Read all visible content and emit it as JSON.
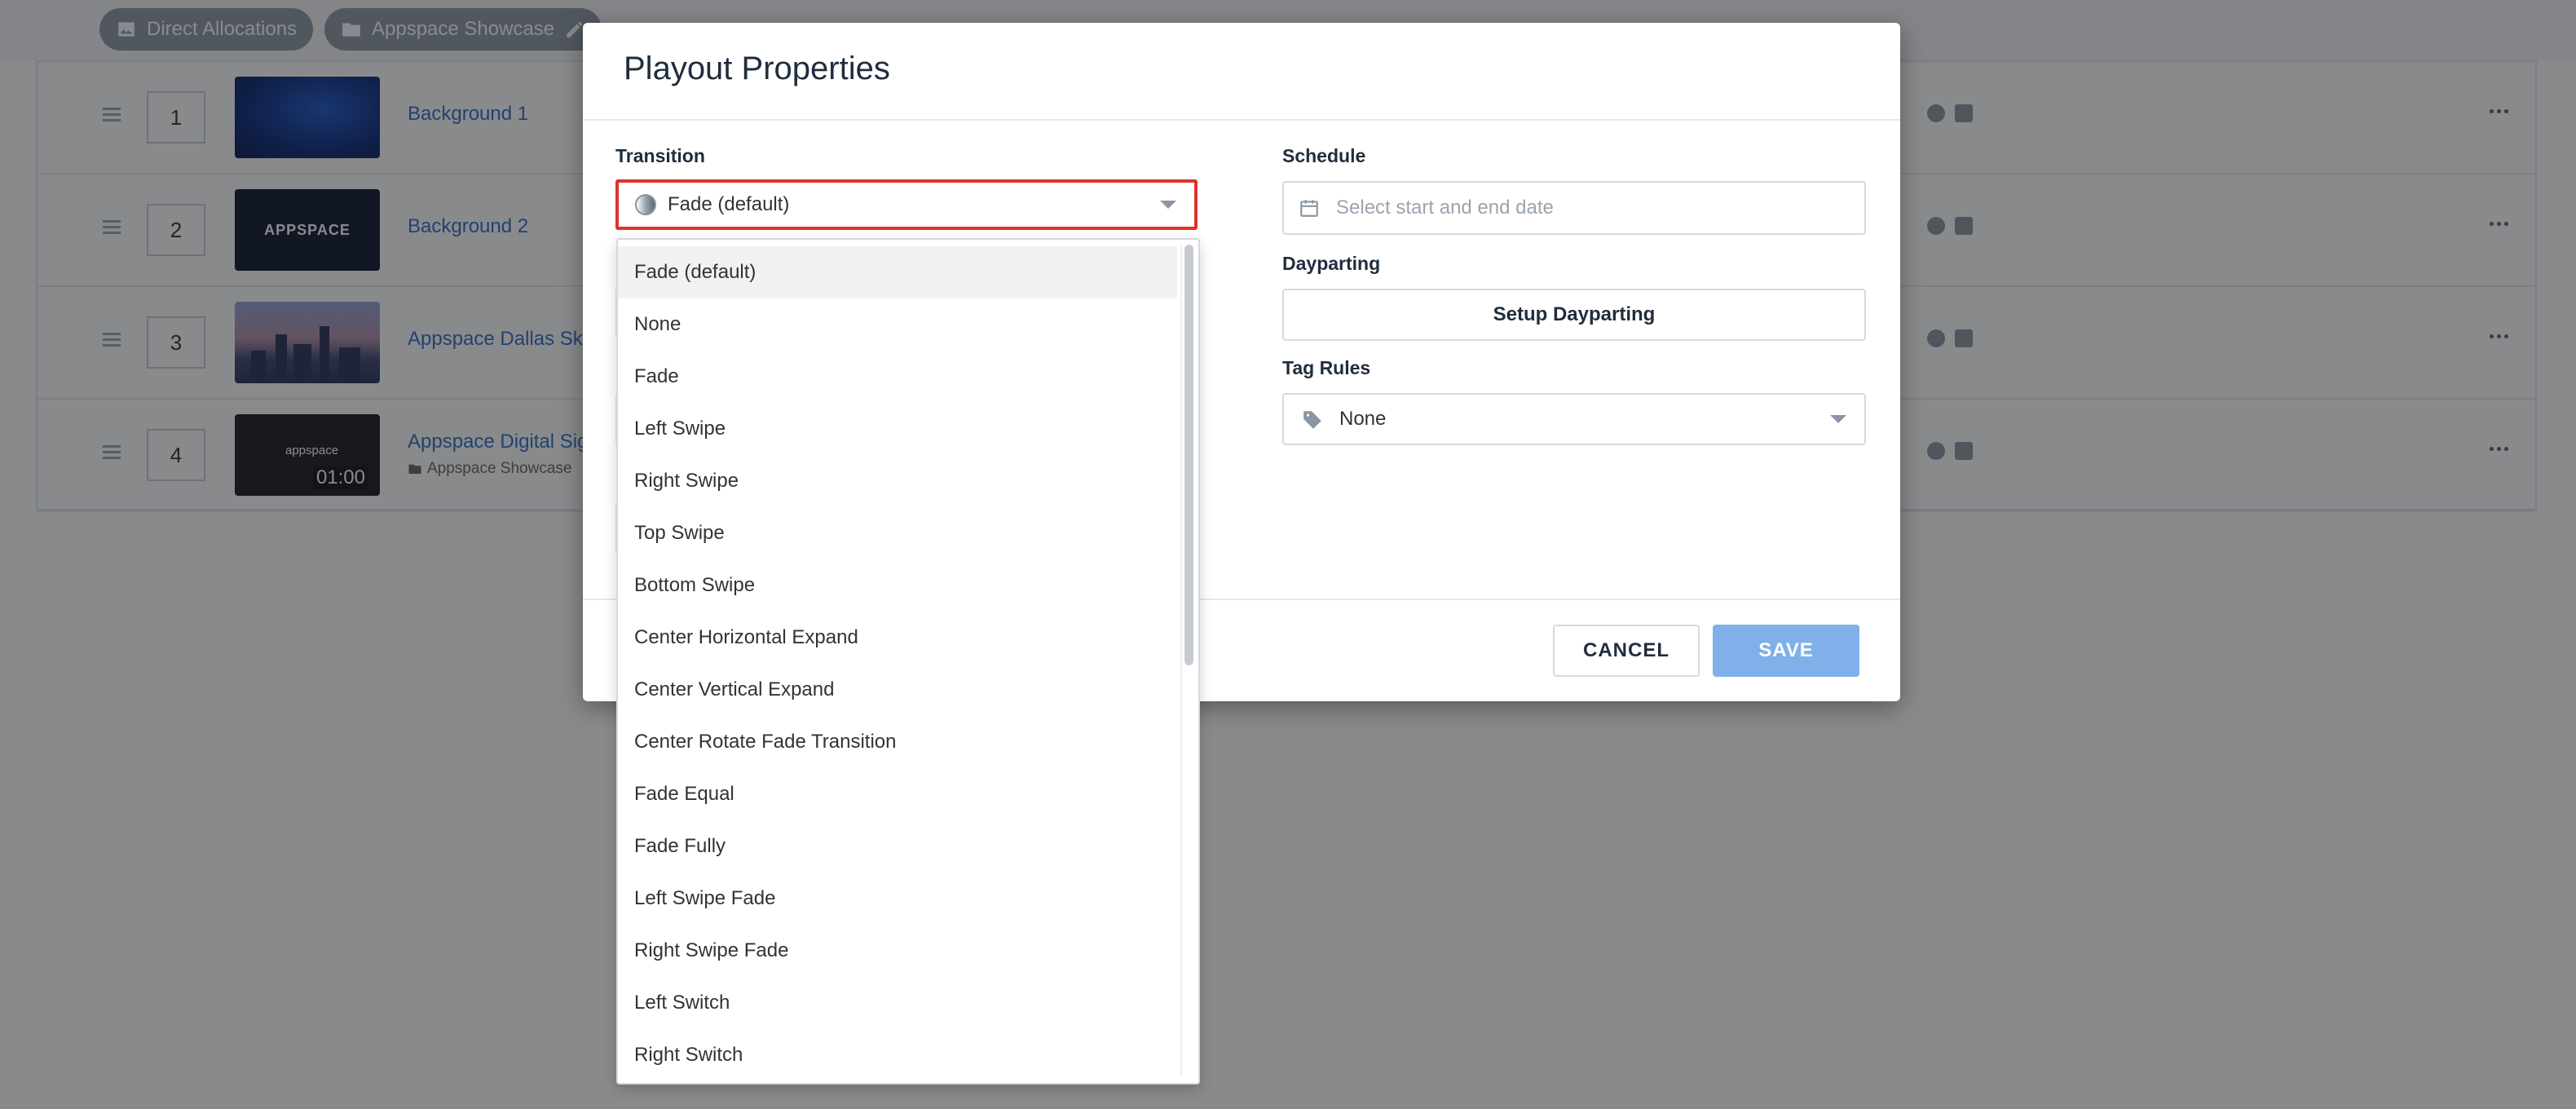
{
  "breadcrumbs": [
    {
      "label": "Direct Allocations",
      "icon": "image-icon"
    },
    {
      "label": "Appspace Showcase",
      "icon": "folder-icon"
    }
  ],
  "playlist_rows": [
    {
      "index": "1",
      "title": "Background 1",
      "subtitle": ""
    },
    {
      "index": "2",
      "title": "Background 2",
      "subtitle": ""
    },
    {
      "index": "3",
      "title": "Appspace Dallas Sky",
      "subtitle": ""
    },
    {
      "index": "4",
      "title": "Appspace Digital Sig",
      "subtitle": "Appspace Showcase"
    }
  ],
  "thumbnail_text": {
    "background2": "APPSPACE",
    "digital_signage_logo": "appspace",
    "digital_signage_duration": "01:00"
  },
  "modal": {
    "title": "Playout Properties",
    "transition": {
      "label": "Transition",
      "selected": "Fade (default)",
      "options": [
        "Fade (default)",
        "None",
        "Fade",
        "Left Swipe",
        "Right Swipe",
        "Top Swipe",
        "Bottom Swipe",
        "Center Horizontal Expand",
        "Center Vertical Expand",
        "Center Rotate Fade Transition",
        "Fade Equal",
        "Fade Fully",
        "Left Swipe Fade",
        "Right Swipe Fade",
        "Left Switch",
        "Right Switch"
      ]
    },
    "schedule": {
      "label": "Schedule",
      "placeholder": "Select start and end date"
    },
    "dayparting": {
      "label": "Dayparting",
      "button": "Setup Dayparting"
    },
    "tag_rules": {
      "label": "Tag Rules",
      "value": "None"
    },
    "cancel_label": "CANCEL",
    "save_label": "SAVE"
  },
  "colors": {
    "accent": "#2f6fc4",
    "highlight_border": "#e0322a",
    "save_button": "#7fb0ea"
  }
}
